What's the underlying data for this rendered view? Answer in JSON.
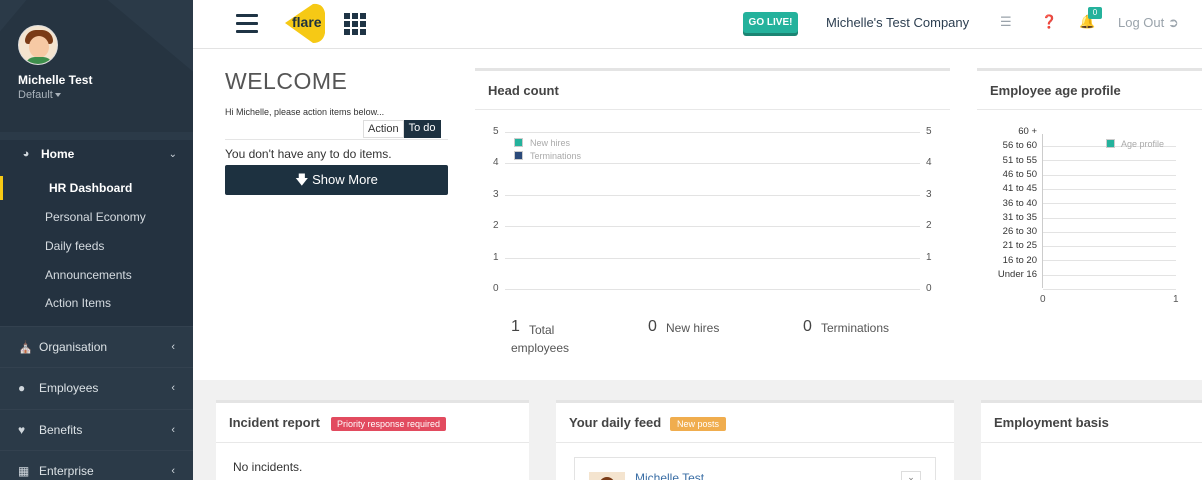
{
  "user": {
    "name": "Michelle Test",
    "role": "Default"
  },
  "sidebar": {
    "home_label": "Home",
    "home_items": [
      "HR Dashboard",
      "Personal Economy",
      "Daily feeds",
      "Announcements",
      "Action Items"
    ],
    "sections": [
      "Organisation",
      "Employees",
      "Benefits",
      "Enterprise"
    ]
  },
  "topbar": {
    "logo_text": "flare",
    "go_live": "GO LIVE!",
    "company": "Michelle's Test Company",
    "notifications": "0",
    "logout": "Log Out"
  },
  "welcome": {
    "title": "WELCOME",
    "greeting": "Hi Michelle, please action items below...",
    "tab_action": "Action",
    "tab_todo": "To do",
    "empty": "You don't have any to do items.",
    "show_more": "Show More"
  },
  "headcount": {
    "title": "Head count",
    "legend": [
      "New hires",
      "Terminations"
    ],
    "stats": [
      {
        "value": "1",
        "label": "Total employees"
      },
      {
        "value": "0",
        "label": "New hires"
      },
      {
        "value": "0",
        "label": "Terminations"
      }
    ]
  },
  "age_profile": {
    "title": "Employee age profile",
    "legend": "Age profile"
  },
  "chart_data": [
    {
      "type": "line",
      "title": "Head count",
      "yticks_left": [
        "5",
        "4",
        "3",
        "2",
        "1",
        "0"
      ],
      "yticks_right": [
        "5",
        "4",
        "3",
        "2",
        "1",
        "0"
      ],
      "ylim": [
        0,
        5
      ],
      "series": [
        {
          "name": "New hires",
          "color": "#24b29c",
          "values": []
        },
        {
          "name": "Terminations",
          "color": "#2b4a7a",
          "values": []
        }
      ],
      "legend_position": "top-left"
    },
    {
      "type": "bar",
      "title": "Employee age profile",
      "categories": [
        "60 +",
        "56 to 60",
        "51 to 55",
        "46 to 50",
        "41 to 45",
        "36 to 40",
        "31 to 35",
        "26 to 30",
        "21 to 25",
        "16 to 20",
        "Under 16"
      ],
      "series": [
        {
          "name": "Age profile",
          "color": "#24b29c",
          "values": [
            0,
            0,
            0,
            0,
            0,
            0,
            0,
            0,
            0,
            0,
            0
          ]
        }
      ],
      "xticks": [
        "0",
        "1"
      ],
      "xlim": [
        0,
        1
      ],
      "legend_position": "top-right"
    }
  ],
  "incident": {
    "title": "Incident report",
    "badge": "Priority response required",
    "empty": "No incidents."
  },
  "feed": {
    "title": "Your daily feed",
    "badge": "New posts",
    "author": "Michelle Test"
  },
  "employment": {
    "title": "Employment basis"
  },
  "colors": {
    "sidebar": "#2b3a48",
    "accent": "#24b29c",
    "dark_button": "#1d3140",
    "logo_yellow": "#f6c915"
  }
}
